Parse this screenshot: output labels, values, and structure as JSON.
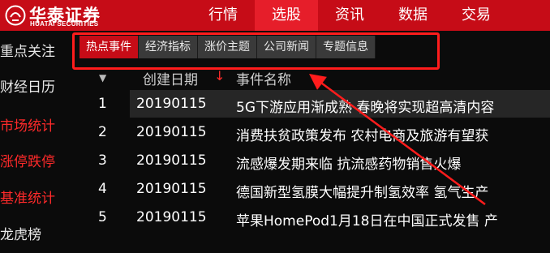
{
  "brand": {
    "name_cn": "华泰证券",
    "name_en": "HUATAI SECURITIES",
    "color": "#c60c17"
  },
  "nav": {
    "items": [
      {
        "label": "行情"
      },
      {
        "label": "选股",
        "active": true
      },
      {
        "label": "资讯"
      },
      {
        "label": "数据"
      },
      {
        "label": "交易"
      }
    ]
  },
  "sidebar": {
    "items": [
      {
        "label": "重点关注",
        "color": "white"
      },
      {
        "label": "财经日历",
        "color": "white"
      },
      {
        "label": "市场统计",
        "color": "red"
      },
      {
        "label": "涨停跌停",
        "color": "red"
      },
      {
        "label": "基准统计",
        "color": "red"
      },
      {
        "label": "龙虎榜",
        "color": "white"
      }
    ]
  },
  "subtabs": {
    "items": [
      {
        "label": "热点事件",
        "active": true
      },
      {
        "label": "经济指标"
      },
      {
        "label": "涨价主题"
      },
      {
        "label": "公司新闻"
      },
      {
        "label": "专题信息"
      }
    ]
  },
  "table": {
    "headers": {
      "date": "创建日期",
      "name": "事件名称"
    },
    "rows": [
      {
        "num": "1",
        "date": "20190115",
        "name": "5G下游应用渐成熟 春晚将实现超高清内容"
      },
      {
        "num": "2",
        "date": "20190115",
        "name": "消费扶贫政策发布 农村电商及旅游有望获"
      },
      {
        "num": "3",
        "date": "20190115",
        "name": "流感爆发期来临 抗流感药物销售火爆"
      },
      {
        "num": "4",
        "date": "20190115",
        "name": "德国新型氢膜大幅提升制氢效率 氢气生产"
      },
      {
        "num": "5",
        "date": "20190115",
        "name": "苹果HomePod1月18日在中国正式发售 产"
      }
    ]
  },
  "annotation_color": "#ff1c1c"
}
